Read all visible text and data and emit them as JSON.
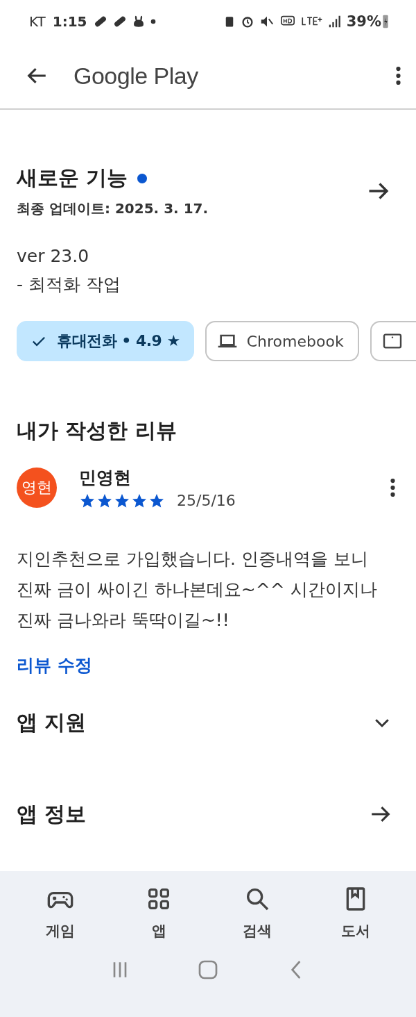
{
  "status_bar": {
    "carrier": "KT",
    "time": "1:15",
    "battery": "39%"
  },
  "app_bar": {
    "title": "Google Play"
  },
  "whats_new": {
    "title": "새로운 기능",
    "unread": true,
    "updated": "최종 업데이트: 2025. 3. 17.",
    "notes": [
      "ver 23.0",
      "- 최적화 작업"
    ]
  },
  "device_chips": [
    {
      "kind": "phone",
      "label": "휴대전화 • 4.9 ★",
      "selected": true
    },
    {
      "kind": "laptop",
      "label": "Chromebook",
      "selected": false
    },
    {
      "kind": "tablet",
      "selected": false
    }
  ],
  "my_review": {
    "title": "내가 작성한 리뷰",
    "avatar": "영현",
    "author": "민영현",
    "stars": 5,
    "date": "25/5/16",
    "text": "지인추천으로 가입했습니다. 인증내역을 보니 진짜 금이 싸이긴 하나본데요~^^ 시간이지나 진짜 금나와라 뚝딱이길~!!",
    "edit_link": "리뷰 수정"
  },
  "sections": [
    {
      "kind": "expand",
      "title": "앱 지원"
    },
    {
      "kind": "link",
      "title": "앱 정보"
    }
  ],
  "bottom_nav": [
    {
      "kind": "games",
      "label": "게임",
      "selected": false
    },
    {
      "kind": "apps",
      "label": "앱",
      "selected": false
    },
    {
      "kind": "search",
      "label": "검색",
      "selected": false
    },
    {
      "kind": "books",
      "label": "도서",
      "selected": false
    }
  ]
}
